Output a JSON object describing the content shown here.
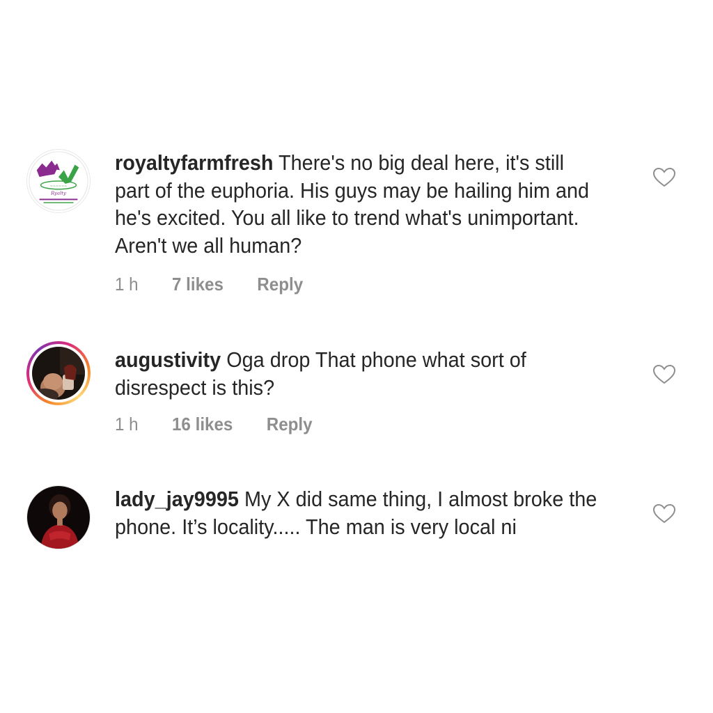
{
  "comments": [
    {
      "username": "royaltyfarmfresh",
      "text": "There's no big deal here, it's still part of the euphoria. His guys may be hailing him and he's excited. You all like to trend what's unimportant. Aren't we all human?",
      "time": "1 h",
      "likes": "7 likes",
      "reply": "Reply",
      "avatar_icon": "farm-logo-avatar"
    },
    {
      "username": "augustivity",
      "text": "Oga drop  That  phone what sort of disrespect is this?",
      "time": "1 h",
      "likes": "16 likes",
      "reply": "Reply",
      "avatar_icon": "user-photo-avatar"
    },
    {
      "username": "lady_jay9995",
      "text": "My X did same thing, I almost broke the phone. It’s locality..... The man is very local ni",
      "avatar_icon": "user-photo-avatar"
    }
  ],
  "colors": {
    "text": "#262626",
    "meta": "#8e8e8e",
    "heart_outline": "#8e8e8e"
  }
}
